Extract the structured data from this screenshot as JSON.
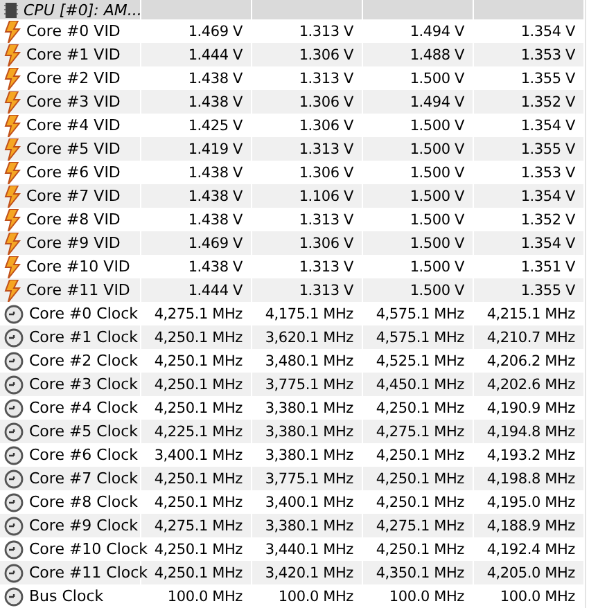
{
  "group": {
    "title": "CPU [#0]: AM..."
  },
  "rows": [
    {
      "kind": "voltage",
      "label": "Core #0 VID",
      "values": [
        "1.469 V",
        "1.313 V",
        "1.494 V",
        "1.354 V"
      ]
    },
    {
      "kind": "voltage",
      "label": "Core #1 VID",
      "values": [
        "1.444 V",
        "1.306 V",
        "1.488 V",
        "1.353 V"
      ]
    },
    {
      "kind": "voltage",
      "label": "Core #2 VID",
      "values": [
        "1.438 V",
        "1.313 V",
        "1.500 V",
        "1.355 V"
      ]
    },
    {
      "kind": "voltage",
      "label": "Core #3 VID",
      "values": [
        "1.438 V",
        "1.306 V",
        "1.494 V",
        "1.352 V"
      ]
    },
    {
      "kind": "voltage",
      "label": "Core #4 VID",
      "values": [
        "1.425 V",
        "1.306 V",
        "1.500 V",
        "1.354 V"
      ]
    },
    {
      "kind": "voltage",
      "label": "Core #5 VID",
      "values": [
        "1.419 V",
        "1.313 V",
        "1.500 V",
        "1.355 V"
      ]
    },
    {
      "kind": "voltage",
      "label": "Core #6 VID",
      "values": [
        "1.438 V",
        "1.306 V",
        "1.500 V",
        "1.353 V"
      ]
    },
    {
      "kind": "voltage",
      "label": "Core #7 VID",
      "values": [
        "1.438 V",
        "1.106 V",
        "1.500 V",
        "1.354 V"
      ]
    },
    {
      "kind": "voltage",
      "label": "Core #8 VID",
      "values": [
        "1.438 V",
        "1.313 V",
        "1.500 V",
        "1.352 V"
      ]
    },
    {
      "kind": "voltage",
      "label": "Core #9 VID",
      "values": [
        "1.469 V",
        "1.306 V",
        "1.500 V",
        "1.354 V"
      ]
    },
    {
      "kind": "voltage",
      "label": "Core #10 VID",
      "values": [
        "1.438 V",
        "1.313 V",
        "1.500 V",
        "1.351 V"
      ]
    },
    {
      "kind": "voltage",
      "label": "Core #11 VID",
      "values": [
        "1.444 V",
        "1.313 V",
        "1.500 V",
        "1.355 V"
      ]
    },
    {
      "kind": "clock",
      "label": "Core #0 Clock",
      "values": [
        "4,275.1 MHz",
        "4,175.1 MHz",
        "4,575.1 MHz",
        "4,215.1 MHz"
      ]
    },
    {
      "kind": "clock",
      "label": "Core #1 Clock",
      "values": [
        "4,250.1 MHz",
        "3,620.1 MHz",
        "4,575.1 MHz",
        "4,210.7 MHz"
      ]
    },
    {
      "kind": "clock",
      "label": "Core #2 Clock",
      "values": [
        "4,250.1 MHz",
        "3,480.1 MHz",
        "4,525.1 MHz",
        "4,206.2 MHz"
      ]
    },
    {
      "kind": "clock",
      "label": "Core #3 Clock",
      "values": [
        "4,250.1 MHz",
        "3,775.1 MHz",
        "4,450.1 MHz",
        "4,202.6 MHz"
      ]
    },
    {
      "kind": "clock",
      "label": "Core #4 Clock",
      "values": [
        "4,250.1 MHz",
        "3,380.1 MHz",
        "4,250.1 MHz",
        "4,190.9 MHz"
      ]
    },
    {
      "kind": "clock",
      "label": "Core #5 Clock",
      "values": [
        "4,225.1 MHz",
        "3,380.1 MHz",
        "4,275.1 MHz",
        "4,194.8 MHz"
      ]
    },
    {
      "kind": "clock",
      "label": "Core #6 Clock",
      "values": [
        "3,400.1 MHz",
        "3,380.1 MHz",
        "4,250.1 MHz",
        "4,193.2 MHz"
      ]
    },
    {
      "kind": "clock",
      "label": "Core #7 Clock",
      "values": [
        "4,250.1 MHz",
        "3,775.1 MHz",
        "4,250.1 MHz",
        "4,198.8 MHz"
      ]
    },
    {
      "kind": "clock",
      "label": "Core #8 Clock",
      "values": [
        "4,250.1 MHz",
        "3,400.1 MHz",
        "4,250.1 MHz",
        "4,195.0 MHz"
      ]
    },
    {
      "kind": "clock",
      "label": "Core #9 Clock",
      "values": [
        "4,275.1 MHz",
        "3,380.1 MHz",
        "4,275.1 MHz",
        "4,188.9 MHz"
      ]
    },
    {
      "kind": "clock",
      "label": "Core #10 Clock",
      "values": [
        "4,250.1 MHz",
        "3,440.1 MHz",
        "4,250.1 MHz",
        "4,192.4 MHz"
      ]
    },
    {
      "kind": "clock",
      "label": "Core #11 Clock",
      "values": [
        "4,250.1 MHz",
        "3,420.1 MHz",
        "4,350.1 MHz",
        "4,205.0 MHz"
      ]
    },
    {
      "kind": "clock",
      "label": "Bus Clock",
      "values": [
        "100.0 MHz",
        "100.0 MHz",
        "100.0 MHz",
        "100.0 MHz"
      ]
    }
  ]
}
